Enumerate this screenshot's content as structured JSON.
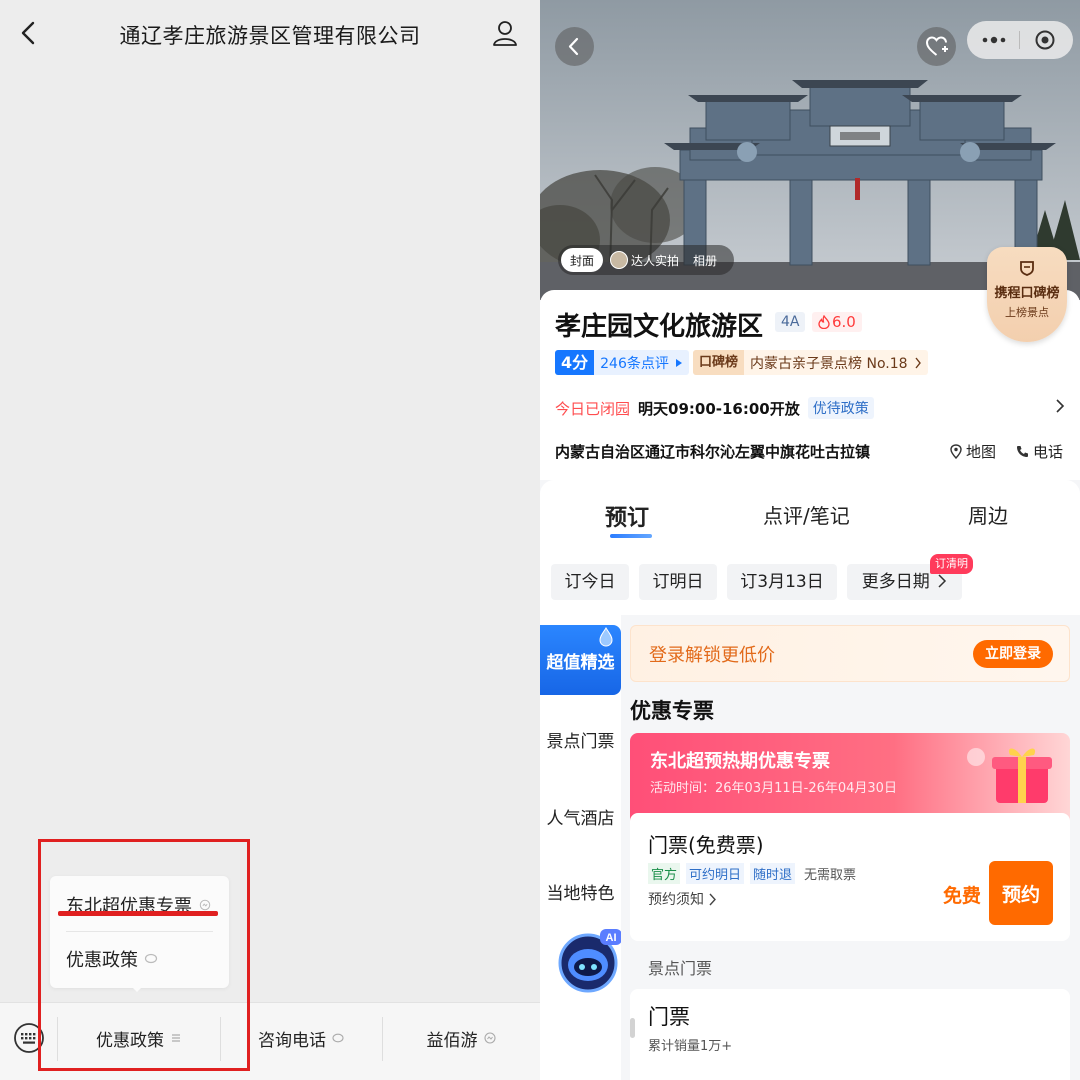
{
  "colors": {
    "wechat_bg": "#ededed",
    "highlight_red": "#e02020",
    "brand_blue": "#1677ff",
    "orange": "#ff6a00",
    "promo_pink": "#ff4f78"
  },
  "left": {
    "nav": {
      "back_icon": "chevron-left-icon",
      "title": "通辽孝庄旅游景区管理有限公司",
      "profile_icon": "user-icon"
    },
    "submenu": {
      "items": [
        {
          "label": "东北超优惠专票",
          "icon": "mini-program-icon"
        },
        {
          "label": "优惠政策",
          "icon": "chat-bubble-icon"
        }
      ]
    },
    "bottom_menu": {
      "keyboard_icon": "keyboard-icon",
      "items": [
        {
          "label": "优惠政策",
          "icon": "menu-lines-icon"
        },
        {
          "label": "咨询电话",
          "icon": "chat-bubble-icon"
        },
        {
          "label": "益佰游",
          "icon": "mini-program-icon"
        }
      ]
    }
  },
  "right": {
    "hero": {
      "photo_tabs": [
        "封面",
        "达人实拍",
        "相册"
      ],
      "badge": {
        "title": "携程口碑榜",
        "subtitle": "上榜景点"
      }
    },
    "info": {
      "title": "孝庄园文化旅游区",
      "level": "4A",
      "heat": "6.0",
      "score": "4分",
      "reviews": "246条点评",
      "rank_tag": "口碑榜",
      "rank_text": "内蒙古亲子景点榜 No.18",
      "status_closed": "今日已闭园",
      "hours": "明天09:00-16:00开放",
      "policy": "优待政策",
      "address": "内蒙古自治区通辽市科尔沁左翼中旗花吐古拉镇",
      "map": "地图",
      "phone": "电话"
    },
    "tabs": [
      "预订",
      "点评/笔记",
      "周边"
    ],
    "dates": [
      "订今日",
      "订明日",
      "订3月13日",
      "更多日期"
    ],
    "date_tag": "订清明",
    "side_nav": [
      "超值精选",
      "景点门票",
      "人气酒店",
      "当地特色"
    ],
    "login_bar": {
      "text": "登录解锁更低价",
      "button": "立即登录"
    },
    "section_title": "优惠专票",
    "promo": {
      "title": "东北超预热期优惠专票",
      "date": "活动时间：26年03月11日-26年04月30日"
    },
    "ticket1": {
      "name": "门票(免费票)",
      "tags": [
        "官方",
        "可约明日",
        "随时退",
        "无需取票"
      ],
      "notice": "预约须知",
      "price": "免费",
      "button": "预约"
    },
    "sub_title": "景点门票",
    "ticket2": {
      "name": "门票",
      "sales": "累计销量1万+"
    },
    "ai_label": "AI"
  }
}
